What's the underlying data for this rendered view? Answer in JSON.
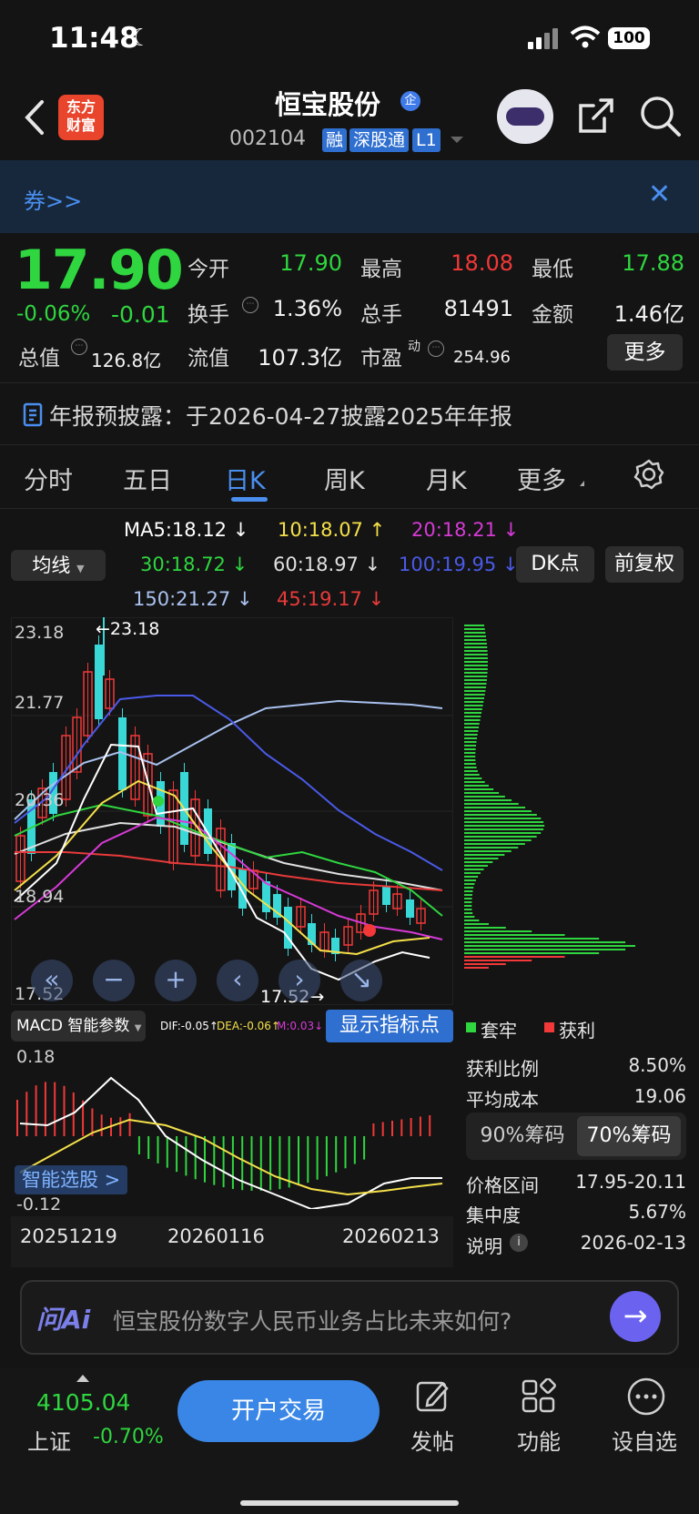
{
  "status": {
    "time": "11:48",
    "battery": "100"
  },
  "header": {
    "stock_name": "恒宝股份",
    "enterprise_tag": "企",
    "code": "002104",
    "tags": [
      "融",
      "深股通",
      "L1"
    ],
    "logo_line1": "东方",
    "logo_line2": "财富"
  },
  "banner": {
    "text": "券>>"
  },
  "quote": {
    "price": "17.90",
    "change_pct": "-0.06%",
    "change_amt": "-0.01",
    "open_label": "今开",
    "open": "17.90",
    "high_label": "最高",
    "high": "18.08",
    "low_label": "最低",
    "low": "17.88",
    "turnover_label": "换手",
    "turnover": "1.36%",
    "volume_label": "总手",
    "volume": "81491",
    "amount_label": "金额",
    "amount": "1.46亿",
    "mktcap_label": "总值",
    "mktcap": "126.8亿",
    "float_label": "流值",
    "float_cap": "107.3亿",
    "pe_label": "市盈",
    "pe_sup": "动",
    "pe": "254.96",
    "more": "更多"
  },
  "notice": {
    "text": "年报预披露：于2026-04-27披露2025年年报"
  },
  "tabs": [
    "分时",
    "五日",
    "日K",
    "周K",
    "月K",
    "更多"
  ],
  "ma": {
    "selector": "均线",
    "items": [
      {
        "label": "MA5:18.12 ↓",
        "color": "#ffffff"
      },
      {
        "label": "10:18.07 ↑",
        "color": "#f4e04a"
      },
      {
        "label": "20:18.21 ↓",
        "color": "#d63ad6"
      },
      {
        "label": "30:18.72 ↓",
        "color": "#2fd63f"
      },
      {
        "label": "60:18.97 ↓",
        "color": "#e0e0e0"
      },
      {
        "label": "100:19.95 ↓",
        "color": "#4a5ae8"
      },
      {
        "label": "150:21.27 ↓",
        "color": "#a9c1ee"
      },
      {
        "label": "45:19.17 ↓",
        "color": "#e83a3a"
      }
    ],
    "dk": "DK点",
    "fq": "前复权"
  },
  "kchart": {
    "y_ticks": [
      "23.18",
      "21.77",
      "20.36",
      "18.94",
      "17.52"
    ],
    "max_mark": "←23.18",
    "min_mark": "17.52→"
  },
  "macd": {
    "selector": "MACD 智能参数",
    "dif": "DIF:-0.05↑",
    "dea": "DEA:-0.06↑",
    "m": "M:0.03↓",
    "show_btn": "显示指标点",
    "y_top": "0.18",
    "y_bottom": "-0.12",
    "smart": "智能选股 >",
    "dates": [
      "20251219",
      "20260116",
      "20260213"
    ]
  },
  "chips": {
    "legend_trapped": "套牢",
    "legend_profit": "获利",
    "rows": [
      {
        "label": "获利比例",
        "value": "8.50%"
      },
      {
        "label": "平均成本",
        "value": "19.06"
      }
    ],
    "btn90": "90%筹码",
    "btn70": "70%筹码",
    "rows2": [
      {
        "label": "价格区间",
        "value": "17.95-20.11"
      },
      {
        "label": "集中度",
        "value": "5.67%"
      },
      {
        "label": "说明",
        "value": "2026-02-13"
      }
    ]
  },
  "ask": {
    "brand": "问Ai",
    "placeholder": "恒宝股份数字人民币业务占比未来如何?"
  },
  "bottom": {
    "index_value": "4105.04",
    "index_name": "上证",
    "index_chg": "-0.70%",
    "trade": "开户交易",
    "post": "发帖",
    "func": "功能",
    "watch": "设自选"
  }
}
